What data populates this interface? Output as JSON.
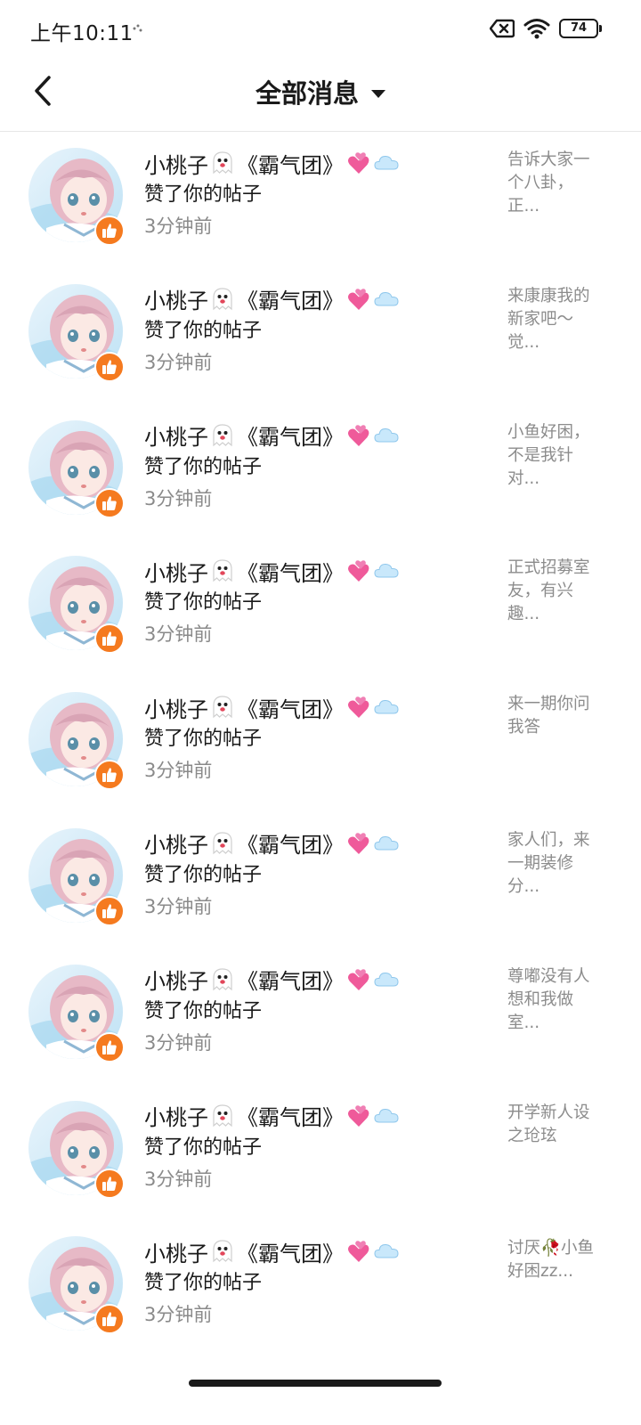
{
  "status_bar": {
    "time": "上午10:11",
    "battery": "74",
    "icons": [
      "mute-x-icon",
      "wifi-icon",
      "battery-icon"
    ]
  },
  "header": {
    "title": "全部消息",
    "back_icon": "chevron-left-icon",
    "dropdown_icon": "caret-down-icon"
  },
  "colors": {
    "like_badge": "#f57a1f",
    "snippet_text": "#8c8c8c",
    "time_text": "#8a8a8a"
  },
  "notifications": [
    {
      "name": "小桃子",
      "group": "《霸气团》",
      "action": "赞了你的帖子",
      "time": "3分钟前",
      "snippet": "告诉大家一个八卦，正..."
    },
    {
      "name": "小桃子",
      "group": "《霸气团》",
      "action": "赞了你的帖子",
      "time": "3分钟前",
      "snippet": "来康康我的新家吧～觉..."
    },
    {
      "name": "小桃子",
      "group": "《霸气团》",
      "action": "赞了你的帖子",
      "time": "3分钟前",
      "snippet": "小鱼好困，不是我针对..."
    },
    {
      "name": "小桃子",
      "group": "《霸气团》",
      "action": "赞了你的帖子",
      "time": "3分钟前",
      "snippet": "正式招募室友，有兴趣..."
    },
    {
      "name": "小桃子",
      "group": "《霸气团》",
      "action": "赞了你的帖子",
      "time": "3分钟前",
      "snippet": "来一期你问我答"
    },
    {
      "name": "小桃子",
      "group": "《霸气团》",
      "action": "赞了你的帖子",
      "time": "3分钟前",
      "snippet": "家人们，来一期装修分..."
    },
    {
      "name": "小桃子",
      "group": "《霸气团》",
      "action": "赞了你的帖子",
      "time": "3分钟前",
      "snippet": "尊嘟没有人想和我做室..."
    },
    {
      "name": "小桃子",
      "group": "《霸气团》",
      "action": "赞了你的帖子",
      "time": "3分钟前",
      "snippet": "开学新人设之玱玹"
    },
    {
      "name": "小桃子",
      "group": "《霸气团》",
      "action": "赞了你的帖子",
      "time": "3分钟前",
      "snippet": "讨厌🥀小鱼好困zz..."
    }
  ]
}
